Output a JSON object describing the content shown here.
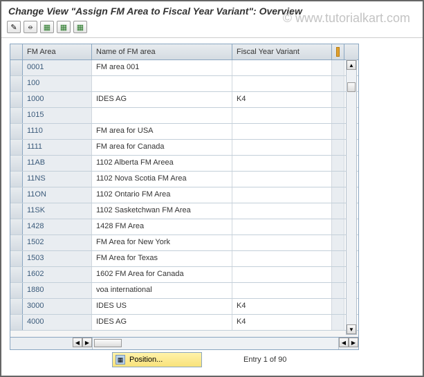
{
  "title": "Change View \"Assign FM Area to Fiscal Year Variant\": Overview",
  "watermark": "© www.tutorialkart.com",
  "toolbar": {
    "btn1": "✎",
    "btn2": "⦵",
    "btn3": "▦",
    "btn4": "▦",
    "btn5": "▦"
  },
  "columns": {
    "fm_area": "FM Area",
    "name": "Name of FM area",
    "fyv": "Fiscal Year Variant"
  },
  "rows": [
    {
      "fm": "0001",
      "name": "FM area 001",
      "fyv": ""
    },
    {
      "fm": "100",
      "name": "",
      "fyv": ""
    },
    {
      "fm": "1000",
      "name": "IDES AG",
      "fyv": "K4"
    },
    {
      "fm": "1015",
      "name": "",
      "fyv": ""
    },
    {
      "fm": "1110",
      "name": "FM area for USA",
      "fyv": ""
    },
    {
      "fm": "1111",
      "name": "FM area for Canada",
      "fyv": ""
    },
    {
      "fm": "11AB",
      "name": "1102 Alberta FM Areea",
      "fyv": ""
    },
    {
      "fm": "11NS",
      "name": "1102 Nova Scotia FM Area",
      "fyv": ""
    },
    {
      "fm": "11ON",
      "name": "1102 Ontario FM Area",
      "fyv": ""
    },
    {
      "fm": "11SK",
      "name": "1102 Sasketchwan FM Area",
      "fyv": ""
    },
    {
      "fm": "1428",
      "name": "1428 FM Area",
      "fyv": ""
    },
    {
      "fm": "1502",
      "name": "FM Area for New York",
      "fyv": ""
    },
    {
      "fm": "1503",
      "name": "FM Area for Texas",
      "fyv": ""
    },
    {
      "fm": "1602",
      "name": "1602 FM Area for Canada",
      "fyv": ""
    },
    {
      "fm": "1880",
      "name": "voa international",
      "fyv": ""
    },
    {
      "fm": "3000",
      "name": "IDES US",
      "fyv": "K4"
    },
    {
      "fm": "4000",
      "name": "IDES AG",
      "fyv": "K4"
    }
  ],
  "footer": {
    "position_label": "Position...",
    "entry_label": "Entry 1 of 90"
  }
}
